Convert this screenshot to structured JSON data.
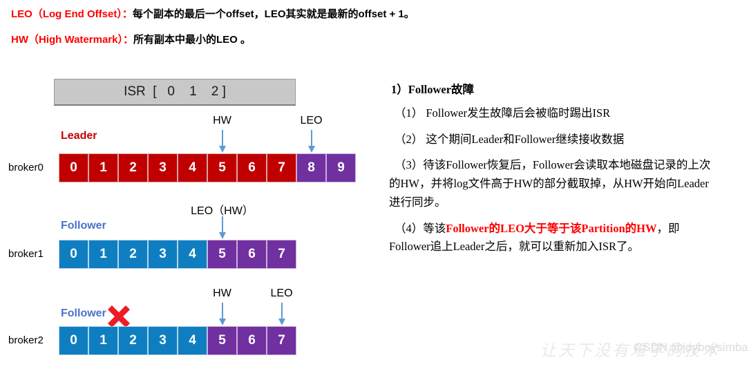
{
  "definitions": [
    {
      "term": "LEO（Log End Offset）：",
      "body": "每个副本的最后一个offset，LEO其实就是最新的offset + 1。"
    },
    {
      "term": "HW（High Watermark）：",
      "body": "所有副本中最小的LEO 。"
    }
  ],
  "colors": {
    "red": "#c00000",
    "purple": "#7030a0",
    "blue": "#0f7ec1",
    "arrow": "#5b9bd5",
    "isr_box": "#c8c8c8",
    "accent_red_text": "#ff0000",
    "follower_label": "#4a72c8"
  },
  "diagram": {
    "isr_label": "ISR  [   0    1    2 ]",
    "rows": [
      {
        "broker": "broker0",
        "role": "Leader",
        "role_color": "red",
        "cells": [
          {
            "value": "0",
            "color": "red"
          },
          {
            "value": "1",
            "color": "red"
          },
          {
            "value": "2",
            "color": "red"
          },
          {
            "value": "3",
            "color": "red"
          },
          {
            "value": "4",
            "color": "red"
          },
          {
            "value": "5",
            "color": "red"
          },
          {
            "value": "6",
            "color": "red"
          },
          {
            "value": "7",
            "color": "red"
          },
          {
            "value": "8",
            "color": "purple"
          },
          {
            "value": "9",
            "color": "purple"
          }
        ],
        "markers": [
          {
            "label": "HW",
            "cell_index": 5
          },
          {
            "label": "LEO",
            "cell_index": 8
          }
        ],
        "failed": false
      },
      {
        "broker": "broker1",
        "role": "Follower",
        "role_color": "blue",
        "cells": [
          {
            "value": "0",
            "color": "blue"
          },
          {
            "value": "1",
            "color": "blue"
          },
          {
            "value": "2",
            "color": "blue"
          },
          {
            "value": "3",
            "color": "blue"
          },
          {
            "value": "4",
            "color": "blue"
          },
          {
            "value": "5",
            "color": "purple"
          },
          {
            "value": "6",
            "color": "purple"
          },
          {
            "value": "7",
            "color": "purple"
          }
        ],
        "markers": [
          {
            "label": "LEO（HW）",
            "cell_index": 5
          }
        ],
        "failed": false
      },
      {
        "broker": "broker2",
        "role": "Follower",
        "role_color": "blue",
        "cells": [
          {
            "value": "0",
            "color": "blue"
          },
          {
            "value": "1",
            "color": "blue"
          },
          {
            "value": "2",
            "color": "blue"
          },
          {
            "value": "3",
            "color": "blue"
          },
          {
            "value": "4",
            "color": "blue"
          },
          {
            "value": "5",
            "color": "purple"
          },
          {
            "value": "6",
            "color": "purple"
          },
          {
            "value": "7",
            "color": "purple"
          }
        ],
        "markers": [
          {
            "label": "HW",
            "cell_index": 5
          },
          {
            "label": "LEO",
            "cell_index": 7
          }
        ],
        "failed": true
      }
    ]
  },
  "notes": {
    "heading": "1）Follower故障",
    "items": [
      "（1） Follower发生故障后会被临时踢出ISR",
      "（2） 这个期间Leader和Follower继续接收数据"
    ],
    "item3_part1": "（3）待该Follower恢复后，Follower会读取本地磁盘记录的上次的HW，并将log文件高于HW的部分截取掉，从HW开始向Leader进行同步。",
    "item4_prefix": "（4）等该",
    "item4_red": "Follower的LEO大于等于该Partition的HW",
    "item4_suffix": "，即Follower追上Leader之后，就可以重新加入ISR了。"
  },
  "watermark": {
    "chinese": "让天下没有难学的技术",
    "csdn": "CSDN @joyboysimba"
  }
}
